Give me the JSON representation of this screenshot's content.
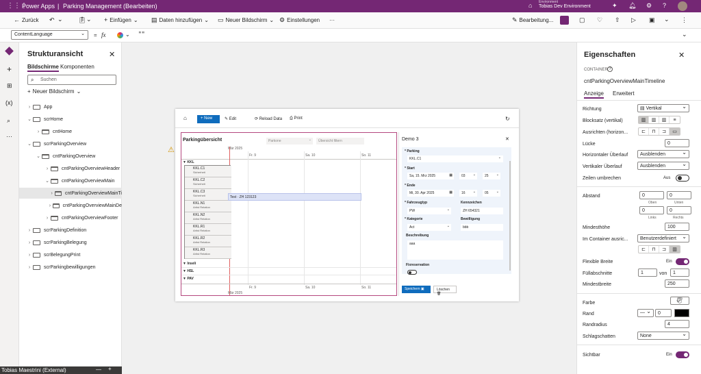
{
  "topbar": {
    "app_name": "Power Apps",
    "separator": "|",
    "doc_title": "Parking Management (Bearbeiten)",
    "env_label": "Environment",
    "env_name": "Tobias Dev Environment",
    "color": "#742774"
  },
  "cmdbar": {
    "back": "Zurück",
    "insert": "Einfügen",
    "add_data": "Daten hinzufügen",
    "new_screen": "Neuer Bildschirm",
    "settings": "Einstellungen",
    "more": "···",
    "edit": "Bearbeitung..."
  },
  "formula": {
    "property": "ContentLanguage",
    "equals": "=",
    "fx": "fx",
    "value": "\"\""
  },
  "tree": {
    "title": "Strukturansicht",
    "tabs": [
      "Bildschirme",
      "Komponenten"
    ],
    "search_placeholder": "Suchen",
    "new_screen": "Neuer Bildschirm",
    "items": [
      {
        "label": "App",
        "level": 0,
        "exp": "›",
        "type": "app"
      },
      {
        "label": "scrHome",
        "level": 0,
        "exp": "⌄",
        "type": "screen"
      },
      {
        "label": "cntHome",
        "level": 1,
        "exp": "›",
        "type": "cnt"
      },
      {
        "label": "scrParkingOverview",
        "level": 0,
        "exp": "⌄",
        "type": "screen"
      },
      {
        "label": "cntParkingOverview",
        "level": 1,
        "exp": "⌄",
        "type": "cnt"
      },
      {
        "label": "cntParkingOverviewHeader",
        "level": 2,
        "exp": "›",
        "type": "cnt"
      },
      {
        "label": "cntParkingOverviewMain",
        "level": 2,
        "exp": "⌄",
        "type": "cnt"
      },
      {
        "label": "cntParkingOverviewMainTi",
        "level": 3,
        "exp": "›",
        "type": "cnt",
        "selected": true
      },
      {
        "label": "cntParkingOverviewMainDe",
        "level": 3,
        "exp": "›",
        "type": "cnt"
      },
      {
        "label": "cntParkingOverviewFooter",
        "level": 2,
        "exp": "›",
        "type": "cnt"
      },
      {
        "label": "scrParkingDefinition",
        "level": 0,
        "exp": "›",
        "type": "screen"
      },
      {
        "label": "scrParkingBelegung",
        "level": 0,
        "exp": "›",
        "type": "screen"
      },
      {
        "label": "scrBelegungPrint",
        "level": 0,
        "exp": "›",
        "type": "screen"
      },
      {
        "label": "scrParkingbewilligungen",
        "level": 0,
        "exp": "›",
        "type": "screen"
      }
    ]
  },
  "bottom_user": {
    "name": "Tobias Maestrini (External)"
  },
  "app": {
    "toolbar": {
      "new": "New",
      "edit": "Edit",
      "reload": "Reload Data",
      "print": "Print"
    },
    "title": "Parkingübersicht",
    "filter1": "Parkone",
    "filter2": "Übersicht filtern",
    "month_top": "Mär 2025",
    "month_bottom": "Mär 2025",
    "days": [
      "Fr. 9",
      "Sa. 10",
      "So. 11"
    ],
    "groups": [
      "KKL",
      "Inseli",
      "HSL",
      "PAV"
    ],
    "resources": [
      {
        "name": "KKL.C1",
        "sub": "Sicherheit"
      },
      {
        "name": "KKL.C2",
        "sub": "Sicherheit"
      },
      {
        "name": "KKL.C3",
        "sub": "Sicherheit"
      },
      {
        "name": "KKL.N1",
        "sub": "Artist Relation"
      },
      {
        "name": "KKL.N2",
        "sub": "Artist Relation"
      },
      {
        "name": "KKL.R1",
        "sub": "Artist Relation"
      },
      {
        "name": "KKL.R2",
        "sub": "Artist Relation"
      },
      {
        "name": "KKL.R3",
        "sub": "Artist Relation"
      }
    ],
    "event": "Test · ZH 123123",
    "detail": {
      "title": "Demo 3",
      "parking_label": "Parking",
      "parking": "KKL.C1",
      "start_label": "Start",
      "start_date": "Sa, 15. Mrz 2025",
      "start_h": "03",
      "start_m": "25",
      "end_label": "Ende",
      "end_date": "Mi, 30. Apr 2025",
      "end_h": "16",
      "end_m": "05",
      "vehicle_label": "Fahrzeugtyp",
      "vehicle": "PW",
      "plate_label": "Kennzeichen",
      "plate": "ZH 654321",
      "cat_label": "Kategorie",
      "cat": "Act",
      "perm_label": "Bewilligung",
      "perm": "bbb",
      "desc_label": "Beschreibung",
      "desc": "aaa",
      "fixed_label": "Fixreservation",
      "save": "Speichern",
      "delete": "Löschen"
    }
  },
  "props": {
    "title": "Eigenschaften",
    "type": "CONTAINER",
    "name": "cntParkingOverviewMainTimeline",
    "tabs": [
      "Anzeige",
      "Erweitert"
    ],
    "richtung_label": "Richtung",
    "richtung": "Vertikal",
    "blocksatz_label": "Blocksatz (vertikal)",
    "ausrichten_label": "Ausrichten (horizon...",
    "luecke_label": "Lücke",
    "luecke": "0",
    "hover_label": "Horizontaler Überlauf",
    "hover": "Ausblenden",
    "vover_label": "Vertikaler Überlauf",
    "vover": "Ausblenden",
    "wrap_label": "Zeilen umbrechen",
    "wrap": "Aus",
    "abstand_label": "Abstand",
    "pad_top": "0",
    "pad_bottom": "0",
    "pad_left": "0",
    "pad_right": "0",
    "oben": "Oben",
    "unten": "Unten",
    "links": "Links",
    "rechts": "Rechts",
    "minh_label": "Mindesthöhe",
    "minh": "100",
    "align_label": "Im Container ausric...",
    "align": "Benutzerdefiniert",
    "flex_label": "Flexible Breite",
    "flex": "Ein",
    "fill_label": "Füllabschnitte",
    "fill": "1",
    "von": "von",
    "fill_of": "1",
    "minw_label": "Mindestbreite",
    "minw": "250",
    "farbe_label": "Farbe",
    "rand_label": "Rand",
    "rand": "0",
    "radius_label": "Randradius",
    "radius": "4",
    "shadow_label": "Schlagschatten",
    "shadow": "None",
    "visible_label": "Sichtbar",
    "visible": "Ein"
  }
}
